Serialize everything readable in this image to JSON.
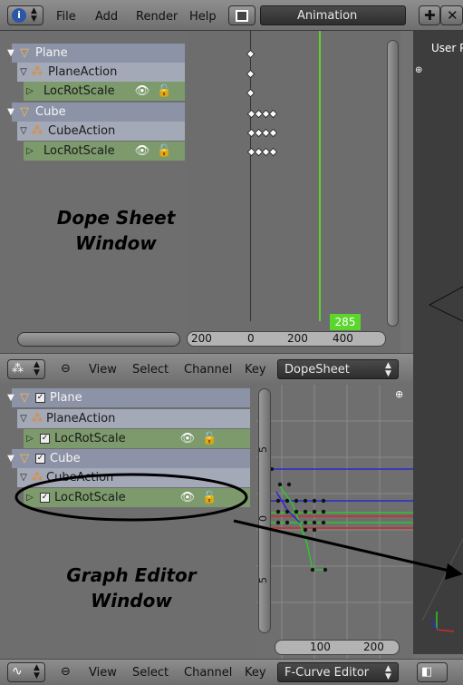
{
  "topbar": {
    "menu": [
      "File",
      "Add",
      "Render",
      "Help"
    ],
    "layout": "Animation"
  },
  "viewport": {
    "label": "User P"
  },
  "dopesheet": {
    "channels": [
      {
        "kind": "obj",
        "label": "Plane"
      },
      {
        "kind": "act",
        "label": "PlaneAction"
      },
      {
        "kind": "chan",
        "label": "LocRotScale"
      },
      {
        "kind": "obj",
        "label": "Cube"
      },
      {
        "kind": "act",
        "label": "CubeAction"
      },
      {
        "kind": "chan",
        "label": "LocRotScale"
      }
    ],
    "ruler": [
      "200",
      "0",
      "200",
      "400"
    ],
    "current_frame": "285",
    "annotation_line1": "Dope Sheet",
    "annotation_line2": "Window",
    "header": {
      "menus": [
        "View",
        "Select",
        "Channel",
        "Key"
      ],
      "mode": "DopeSheet"
    }
  },
  "graph": {
    "channels": [
      {
        "kind": "obj",
        "label": "Plane"
      },
      {
        "kind": "act",
        "label": "PlaneAction"
      },
      {
        "kind": "chan",
        "label": "LocRotScale"
      },
      {
        "kind": "obj",
        "label": "Cube"
      },
      {
        "kind": "act",
        "label": "CubeAction"
      },
      {
        "kind": "chan",
        "label": "LocRotScale"
      }
    ],
    "yticks": [
      "5",
      "0",
      "5"
    ],
    "ruler": [
      "100",
      "200"
    ],
    "annotation_line1": "Graph Editor",
    "annotation_line2": "Window",
    "header": {
      "menus": [
        "View",
        "Select",
        "Channel",
        "Key"
      ],
      "mode": "F-Curve Editor"
    }
  },
  "colors": {
    "object_row": "#8c93a6",
    "action_row": "#a4a9b8",
    "channel_row": "#7d9a6c",
    "current_frame": "#5ad62c"
  }
}
